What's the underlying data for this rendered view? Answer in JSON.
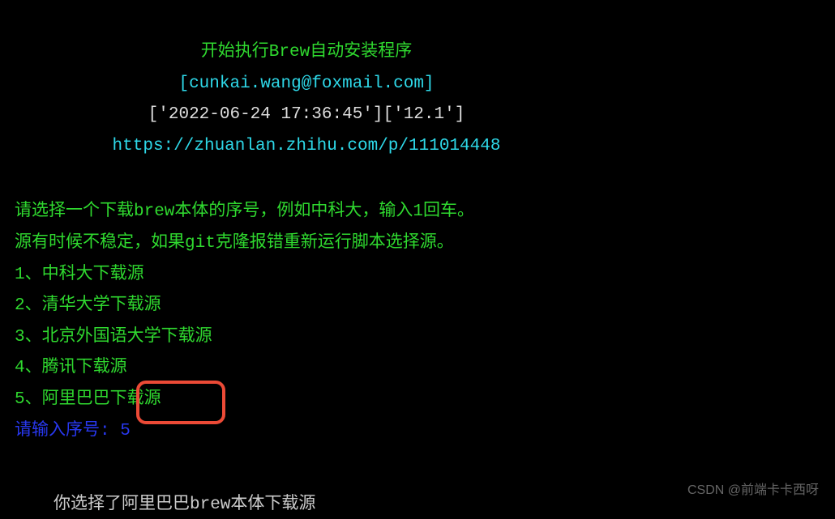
{
  "header": {
    "title": "开始执行Brew自动安装程序",
    "email": "[cunkai.wang@foxmail.com]",
    "timestamp": "['2022-06-24 17:36:45']['12.1']",
    "url": "https://zhuanlan.zhihu.com/p/111014448"
  },
  "instructions": {
    "line1": "请选择一个下载brew本体的序号，例如中科大，输入1回车。",
    "line2": "源有时候不稳定，如果git克隆报错重新运行脚本选择源。"
  },
  "options": [
    "1、中科大下载源",
    "2、清华大学下载源",
    "3、北京外国语大学下载源",
    "4、腾讯下载源",
    "5、阿里巴巴下载源"
  ],
  "prompt": {
    "label": "请输入序号: ",
    "value": "5"
  },
  "result": "你选择了阿里巴巴brew本体下载源",
  "watermark": "CSDN @前端卡卡西呀"
}
